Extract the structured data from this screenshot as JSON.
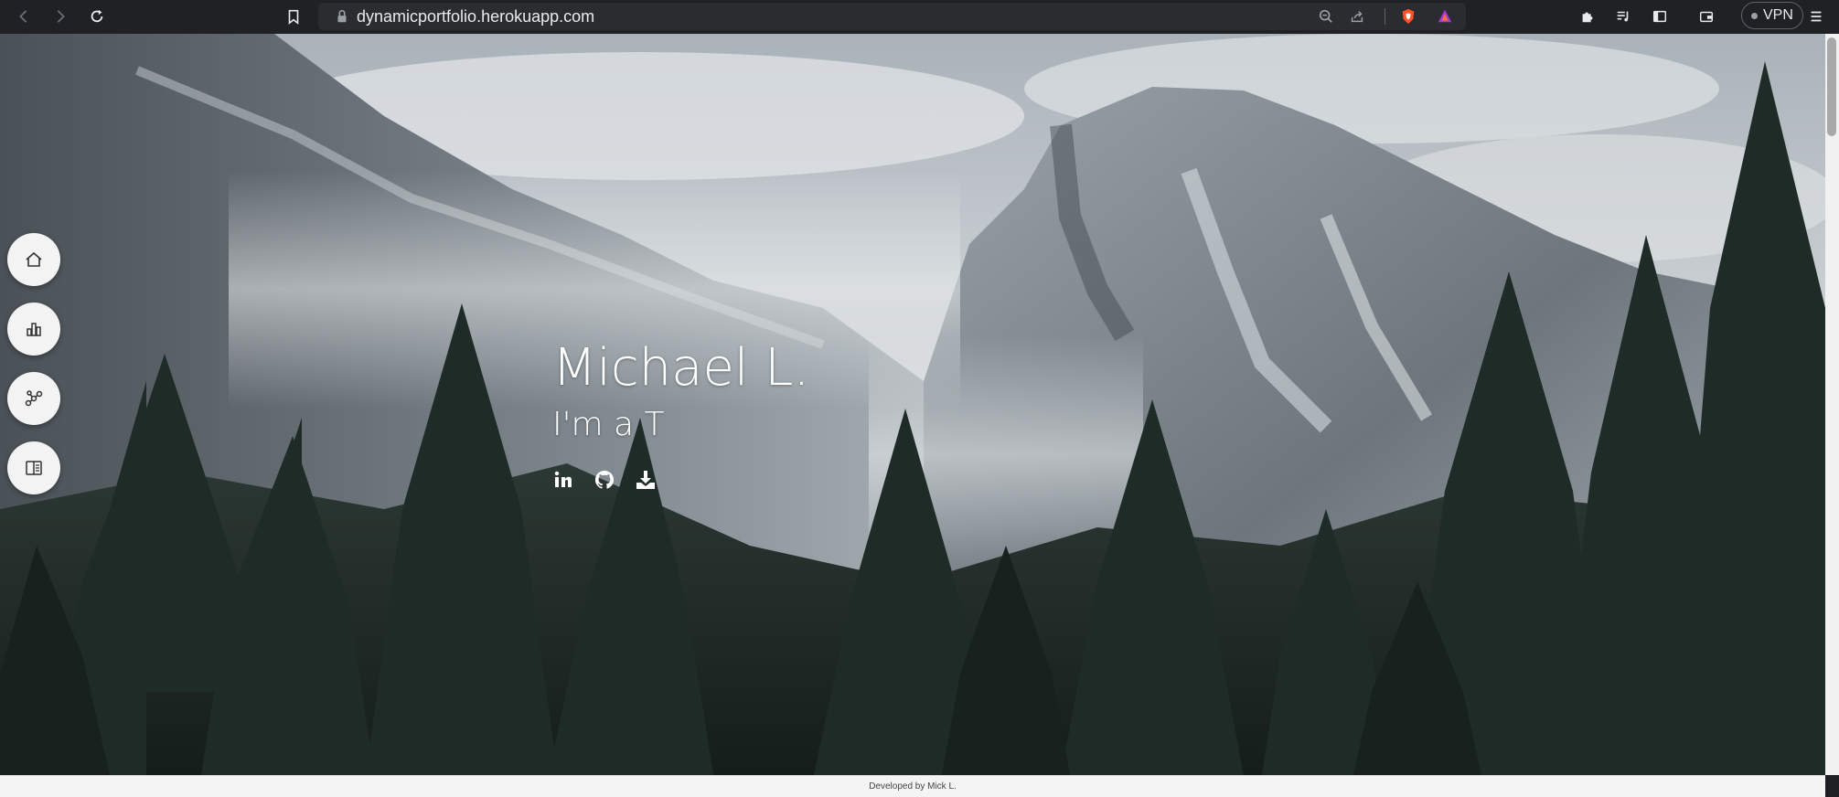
{
  "browser": {
    "url": "dynamicportfolio.herokuapp.com",
    "vpn_label": "VPN"
  },
  "hero": {
    "name": "Michael L.",
    "tagline": "I'm a T"
  },
  "side_nav": {
    "items": [
      {
        "name": "home",
        "icon": "home-icon"
      },
      {
        "name": "skills",
        "icon": "bar-chart-icon"
      },
      {
        "name": "projects",
        "icon": "nodes-icon"
      },
      {
        "name": "resume",
        "icon": "book-icon"
      }
    ]
  },
  "social": {
    "items": [
      "linkedin-icon",
      "github-icon",
      "download-icon"
    ]
  },
  "footer": {
    "text": "Developed by Mick L."
  },
  "colors": {
    "chrome_bg": "#202124",
    "omnibox_bg": "#2b2c30",
    "brave_orange": "#fb542b",
    "side_button_bg": "#f3f3f3"
  }
}
